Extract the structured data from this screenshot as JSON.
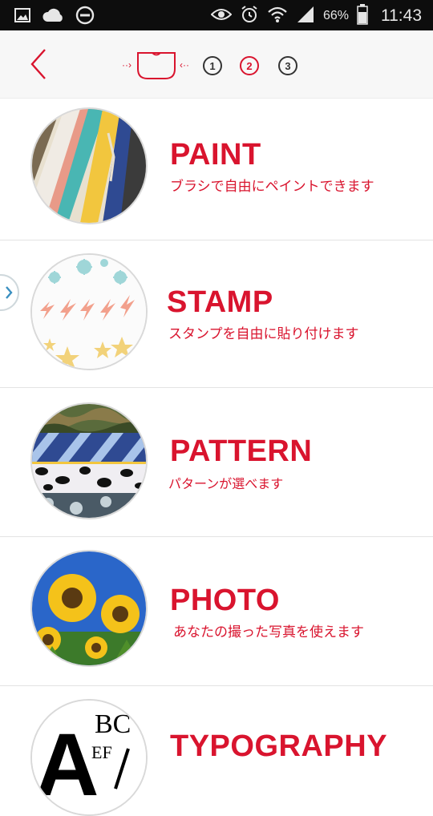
{
  "status_bar": {
    "battery_percent": "66%",
    "time": "11:43",
    "icons": [
      "image-icon",
      "cloud-icon",
      "do-not-disturb-icon",
      "eye-icon",
      "alarm-icon",
      "wifi-icon",
      "signal-icon",
      "battery-icon"
    ]
  },
  "header": {
    "back_icon": "chevron-left-icon",
    "steps": [
      "1",
      "2",
      "3"
    ],
    "active_step": 2
  },
  "items": [
    {
      "title": "PAINT",
      "description": "ブラシで自由にペイントできます"
    },
    {
      "title": "STAMP",
      "description": "スタンプを自由に貼り付けます"
    },
    {
      "title": "PATTERN",
      "description": "パターンが選べます"
    },
    {
      "title": "PHOTO",
      "description": "あなたの撮った写真を使えます"
    },
    {
      "title": "TYPOGRAPHY",
      "description": "",
      "thumb_letters": "A B C E F"
    }
  ],
  "colors": {
    "accent": "#d9142e",
    "header_bg": "#f7f7f7",
    "status_bg": "#0d0d0d"
  }
}
